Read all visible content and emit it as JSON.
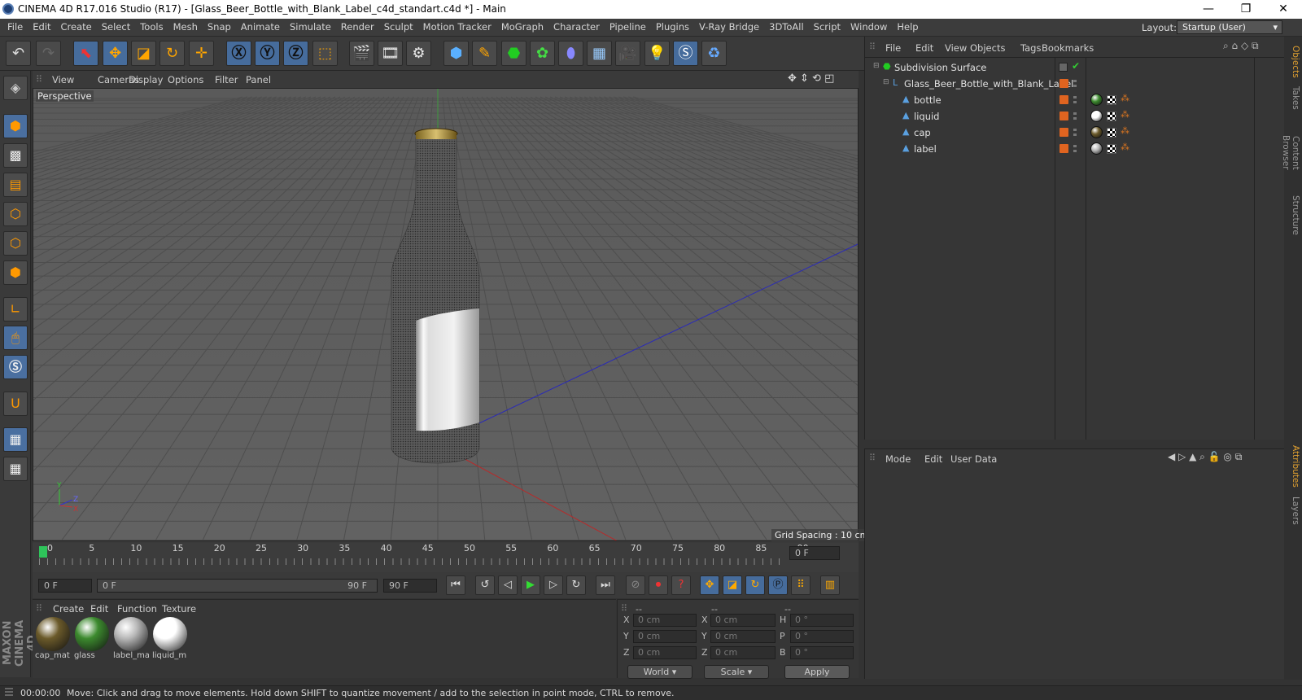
{
  "window": {
    "title": "CINEMA 4D R17.016 Studio (R17) - [Glass_Beer_Bottle_with_Blank_Label_c4d_standart.c4d *] - Main",
    "minimize": "—",
    "restore": "❐",
    "close": "✕"
  },
  "menu": [
    "File",
    "Edit",
    "Create",
    "Select",
    "Tools",
    "Mesh",
    "Snap",
    "Animate",
    "Simulate",
    "Render",
    "Sculpt",
    "Motion Tracker",
    "MoGraph",
    "Character",
    "Pipeline",
    "Plugins",
    "V-Ray Bridge",
    "3DToAll",
    "Script",
    "Window",
    "Help"
  ],
  "layout": {
    "label": "Layout:",
    "value": "Startup (User)"
  },
  "viewport": {
    "menu": [
      "View",
      "Cameras",
      "Display",
      "Options",
      "Filter",
      "Panel"
    ],
    "label": "Perspective",
    "grid_spacing": "Grid Spacing : 10 cm"
  },
  "timeline": {
    "ticks": [
      "0",
      "5",
      "10",
      "15",
      "20",
      "25",
      "30",
      "35",
      "40",
      "45",
      "50",
      "55",
      "60",
      "65",
      "70",
      "75",
      "80",
      "85",
      "90"
    ],
    "current_frame": "0 F",
    "start_field": "0 F",
    "range_start": "0 F",
    "range_end": "90 F",
    "end_field": "90 F"
  },
  "materials": {
    "menu": [
      "Create",
      "Edit",
      "Function",
      "Texture"
    ],
    "items": [
      {
        "name": "cap_mat",
        "color": "#6b5a2a"
      },
      {
        "name": "glass",
        "color": "#3c8a2e"
      },
      {
        "name": "label_ma",
        "color": "#b8b8b8"
      },
      {
        "name": "liquid_m",
        "color": "#ffffff"
      }
    ]
  },
  "coords": {
    "headers": [
      "--",
      "--",
      "--"
    ],
    "rows": [
      {
        "l1": "X",
        "v1": "0 cm",
        "l2": "X",
        "v2": "0 cm",
        "l3": "H",
        "v3": "0 °"
      },
      {
        "l1": "Y",
        "v1": "0 cm",
        "l2": "Y",
        "v2": "0 cm",
        "l3": "P",
        "v3": "0 °"
      },
      {
        "l1": "Z",
        "v1": "0 cm",
        "l2": "Z",
        "v2": "0 cm",
        "l3": "B",
        "v3": "0 °"
      }
    ],
    "mode1": "World",
    "mode2": "Scale",
    "apply": "Apply"
  },
  "objects": {
    "menu": [
      "File",
      "Edit",
      "View",
      "Objects",
      "Tags",
      "Bookmarks"
    ],
    "tree": [
      {
        "name": "Subdivision Surface",
        "level": 0
      },
      {
        "name": "Glass_Beer_Bottle_with_Blank_Label",
        "level": 1
      },
      {
        "name": "bottle",
        "level": 2
      },
      {
        "name": "liquid",
        "level": 2
      },
      {
        "name": "cap",
        "level": 2
      },
      {
        "name": "label",
        "level": 2
      }
    ]
  },
  "attributes": {
    "menu": [
      "Mode",
      "Edit",
      "User Data"
    ]
  },
  "right_tabs": [
    "Objects",
    "Takes",
    "Content Browser",
    "Structure",
    "Attributes",
    "Layers"
  ],
  "status": {
    "time": "00:00:00",
    "message": "Move: Click and drag to move elements. Hold down SHIFT to quantize movement / add to the selection in point mode, CTRL to remove."
  },
  "brand": "MAXON CINEMA 4D"
}
